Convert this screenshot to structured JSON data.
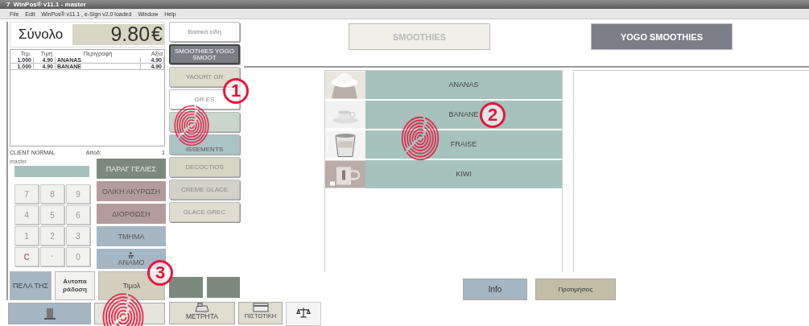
{
  "window": {
    "icon": "7",
    "title": "WinPos® v11.1 - master"
  },
  "menu": [
    "File",
    "Edit",
    "WinPos® v11.1 , e-Sign v2.0 loaded",
    "Window",
    "Help"
  ],
  "total": {
    "label": "Σύνολο",
    "amount": "9.80",
    "currency": "€"
  },
  "receipt": {
    "columns": [
      "Τεμ.",
      "Τιμή",
      "Περιγραφή",
      "Αξία"
    ],
    "rows": [
      [
        "1.000",
        "4.90",
        "ANANAS",
        "4.90"
      ],
      [
        "1.000",
        "4.90",
        "BANANE",
        "4.90"
      ]
    ]
  },
  "client": {
    "name": "CLIENT NORMAL",
    "receipt_label": "Αποδ:",
    "receipt_no": "1",
    "user": "master"
  },
  "functions": [
    {
      "label": "ΠΑΡΑΓ ΓΕΛΙΕΣ",
      "color": "#7b8a7c"
    },
    {
      "label": "ΟΛΙΚΗ ΑΚΥΡΩΣΗ",
      "color": "#b59c9c"
    },
    {
      "label": "ΔΙΟΡΘΩΣΗ",
      "color": "#b59c9c"
    },
    {
      "label": "ΤΜΗΜΑ",
      "color": "#a6b6c3"
    },
    {
      "label": "ΑΝΑΜΟ",
      "color": "#a6b6c3"
    }
  ],
  "keypad": [
    "7",
    "8",
    "9",
    "4",
    "5",
    "6",
    "1",
    "2",
    "3",
    "C",
    ".",
    "0"
  ],
  "lower_buttons": [
    {
      "label": "ΠΕΛΑ ΤΗΣ",
      "color": "#a6b6c3"
    },
    {
      "label": "Αυτοπα ράδοση",
      "color": "#f1f1ee"
    },
    {
      "label": "Τιμολ",
      "color": "#d3cfbe"
    }
  ],
  "payments": [
    "ΜΕΤΡΗΤΑ",
    "ΠΙΣΤΩΤΙΚΗ"
  ],
  "categories": [
    {
      "label": "Βασικά είδη",
      "color": "#ffffff",
      "selected": false
    },
    {
      "label": "SMOOTHIES YOGO SMOOT",
      "color": "#7b7e86",
      "selected": true
    },
    {
      "label": "YAOURT GR",
      "color": "#dcdccd",
      "selected": false
    },
    {
      "label": "GR   ES",
      "color": "#ffffff",
      "selected": false
    },
    {
      "color": "#c8d6cc",
      "selected": false
    },
    {
      "label": "ISSEMENTS",
      "color": "#a9c3c6",
      "selected": false
    },
    {
      "label": "DECOCTIOS",
      "color": "#d6d6c6",
      "selected": false
    },
    {
      "label": "CREME GLACE",
      "color": "#d2d2c8",
      "selected": false
    },
    {
      "label": "GLACE GREC",
      "color": "#deddd0",
      "selected": false
    }
  ],
  "tabs": [
    {
      "label": "SMOOTHIES",
      "selected": false
    },
    {
      "label": "YOGO SMOOTHIES",
      "selected": true
    }
  ],
  "items": [
    {
      "label": "ANANAS"
    },
    {
      "label": "BANANE"
    },
    {
      "label": "FRAISE"
    },
    {
      "label": "KIWI"
    }
  ],
  "actions": [
    {
      "label": "Info",
      "color": "#a6b6c3"
    },
    {
      "label": "Προτιμήσεις",
      "color": "#c3bda6"
    }
  ],
  "annotations": [
    {
      "number": "1"
    },
    {
      "number": "2"
    },
    {
      "number": "3"
    }
  ]
}
